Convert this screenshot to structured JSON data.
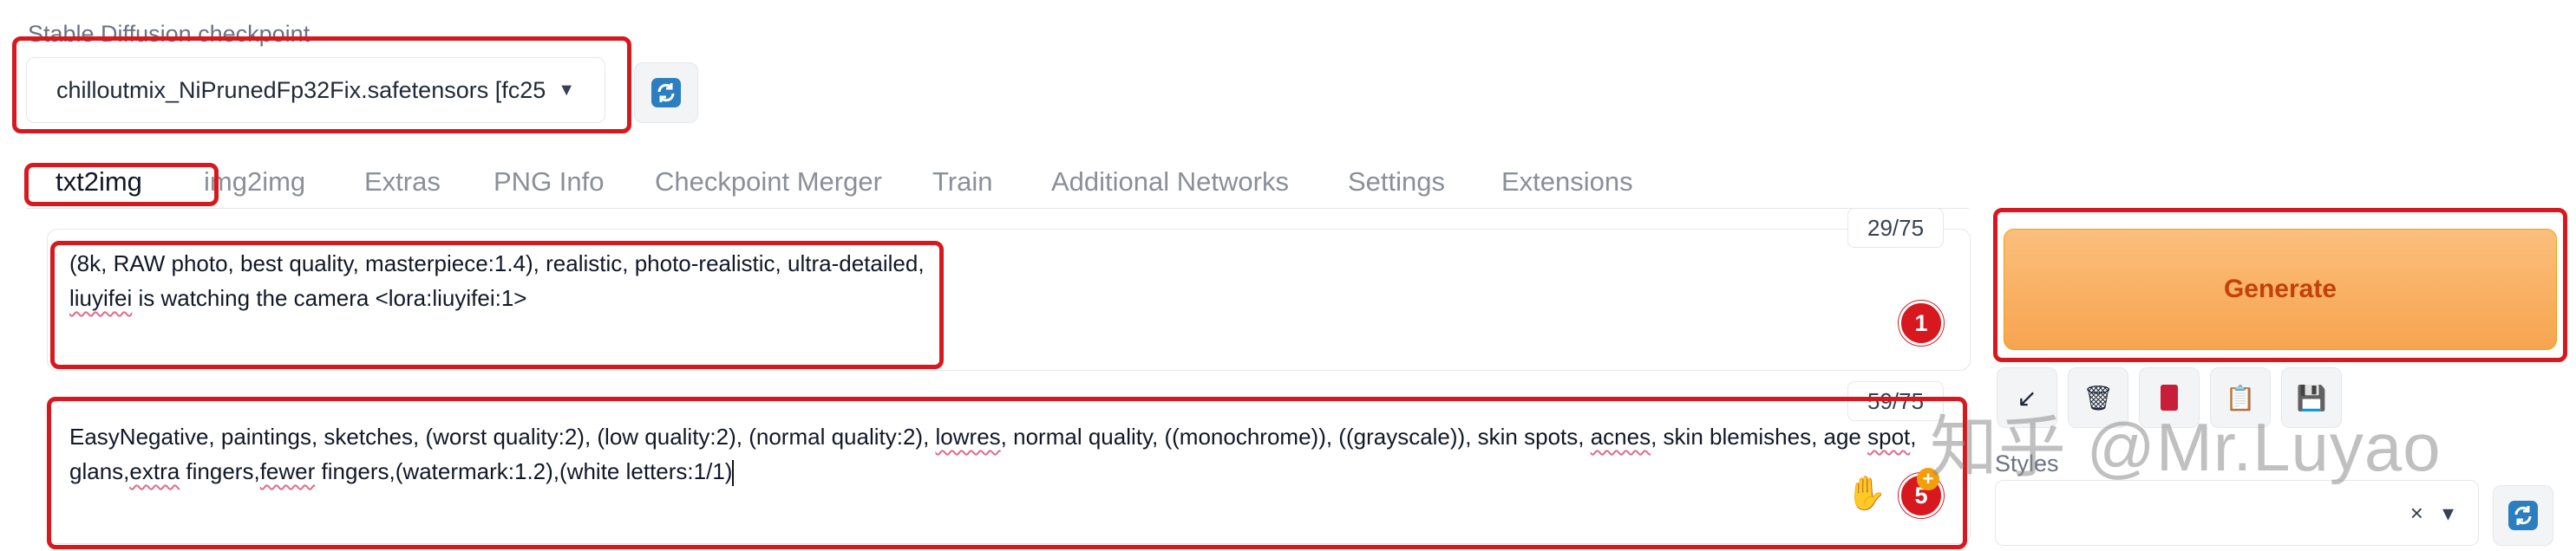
{
  "checkpoint": {
    "label": "Stable Diffusion checkpoint",
    "selected": "chilloutmix_NiPrunedFp32Fix.safetensors [fc25"
  },
  "tabs": [
    {
      "label": "txt2img"
    },
    {
      "label": "img2img"
    },
    {
      "label": "Extras"
    },
    {
      "label": "PNG Info"
    },
    {
      "label": "Checkpoint Merger"
    },
    {
      "label": "Train"
    },
    {
      "label": "Additional Networks"
    },
    {
      "label": "Settings"
    },
    {
      "label": "Extensions"
    }
  ],
  "prompt": {
    "line1": "(8k, RAW photo, best quality, masterpiece:1.4), realistic, photo-realistic, ultra-detailed,",
    "line2_word": "liuyifei",
    "line2_rest": " is watching the camera <lora:liuyifei:1>",
    "token_count": "29/75",
    "badge": "1"
  },
  "negative_prompt": {
    "l1_a": "EasyNegative, paintings, sketches, (worst quality:2), (low quality:2), (normal quality:2), ",
    "l1_lowres": "lowres",
    "l1_b": ", normal quality, ((monochrome)), ((grayscale)), skin spots, ",
    "l1_acnes": "acnes",
    "l1_c": ", skin blemishes, age ",
    "l1_spot": "spot",
    "l1_d": ",",
    "l2_a": "glans,",
    "l2_extra": "extra",
    "l2_b": " fingers,",
    "l2_fewer": "fewer",
    "l2_c": " fingers,(watermark:1.2),(white letters:1/1)",
    "token_count": "59/75",
    "badge": "5"
  },
  "generate": {
    "label": "Generate"
  },
  "styles": {
    "label": "Styles",
    "clear": "×",
    "caret": "▾"
  },
  "watermark": "知乎 @Mr.Luyao",
  "colors": {
    "accent_red": "#d7191f",
    "generate_orange": "#f7a44f"
  }
}
